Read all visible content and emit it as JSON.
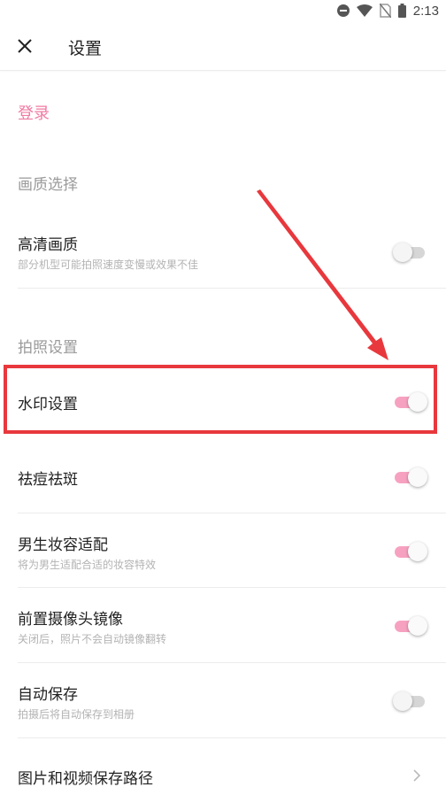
{
  "status_bar": {
    "time": "2:13",
    "icons": [
      "do-not-disturb-icon",
      "wifi-icon",
      "no-sim-icon",
      "battery-icon"
    ]
  },
  "header": {
    "title": "设置",
    "close_icon": "close-icon"
  },
  "login": {
    "label": "登录"
  },
  "sections": {
    "quality": {
      "title": "画质选择"
    },
    "photo": {
      "title": "拍照设置"
    }
  },
  "items": {
    "hd": {
      "label": "高清画质",
      "subtitle": "部分机型可能拍照速度变慢或效果不佳",
      "enabled": false
    },
    "watermark": {
      "label": "水印设置",
      "enabled": true
    },
    "blemish": {
      "label": "祛痘祛斑",
      "enabled": true
    },
    "male_makeup": {
      "label": "男生妆容适配",
      "subtitle": "将为男生适配合适的妆容特效",
      "enabled": true
    },
    "front_mirror": {
      "label": "前置摄像头镜像",
      "subtitle": "关闭后，照片不会自动镜像翻转",
      "enabled": true
    },
    "auto_save": {
      "label": "自动保存",
      "subtitle": "拍摄后将自动保存到相册",
      "enabled": false
    },
    "save_path": {
      "label": "图片和视频保存路径"
    }
  },
  "colors": {
    "accent": "#f07aa3",
    "toggle_on": "#f7a1c0",
    "annotation": "#e8383d"
  }
}
